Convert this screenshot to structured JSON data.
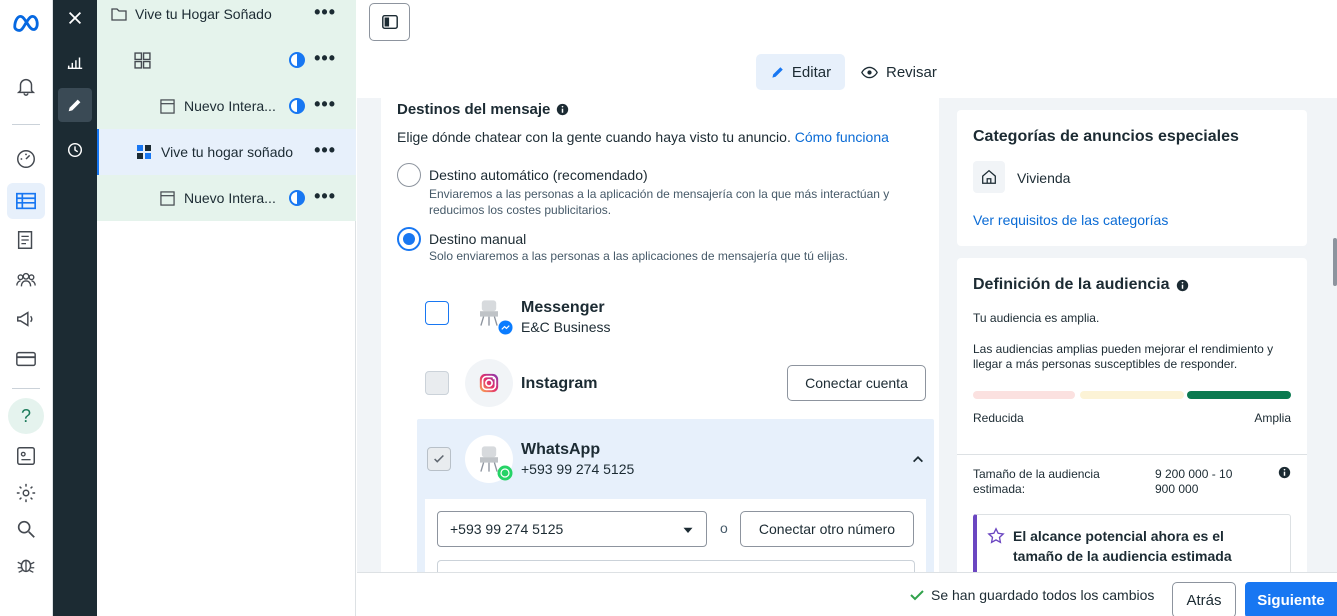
{
  "rail": {
    "icons": [
      "meta-logo-icon",
      "bell-icon",
      "gauge-icon",
      "table-icon",
      "catalog-icon",
      "audience-icon",
      "megaphone-icon",
      "billing-card-icon",
      "help-icon",
      "page-icon",
      "settings-icon",
      "search-icon",
      "bug-icon"
    ]
  },
  "tools": {
    "icons": [
      "close-icon",
      "chart-icon",
      "pencil-icon",
      "history-icon"
    ]
  },
  "tree": {
    "rows": [
      {
        "label": "Vive tu Hogar Soñado"
      },
      {
        "label": ""
      },
      {
        "label": "Nuevo Intera..."
      },
      {
        "label": "Vive tu hogar soñado"
      },
      {
        "label": "Nuevo Intera..."
      }
    ]
  },
  "header": {
    "edit_label": "Editar",
    "review_label": "Revisar"
  },
  "destinations": {
    "title": "Destinos del mensaje",
    "description": "Elige dónde chatear con la gente cuando haya visto tu anuncio.",
    "how_link": "Cómo funciona",
    "auto": {
      "label": "Destino automático (recomendado)",
      "help": "Enviaremos a las personas a la aplicación de mensajería con la que más interactúan y reducimos los costes publicitarios."
    },
    "manual": {
      "label": "Destino manual",
      "help": "Solo enviaremos a las personas a las aplicaciones de mensajería que tú elijas."
    },
    "messenger": {
      "name": "Messenger",
      "sub": "E&C Business"
    },
    "instagram": {
      "name": "Instagram",
      "button": "Conectar cuenta"
    },
    "whatsapp": {
      "name": "WhatsApp",
      "sub": "+593 99 274 5125",
      "select_value": "+593 99 274 5125",
      "or": "o",
      "connect_other": "Conectar otro número"
    }
  },
  "special_categories": {
    "title": "Categorías de anuncios especiales",
    "item": "Vivienda",
    "link": "Ver requisitos de las categorías"
  },
  "audience": {
    "title": "Definición de la audiencia",
    "status": "Tu audiencia es amplia.",
    "info": "Las audiencias amplias pueden mejorar el rendimiento y llegar a más personas susceptibles de responder.",
    "low_label": "Reducida",
    "high_label": "Amplia",
    "size_label": "Tamaño de la audiencia estimada:",
    "size_value": "9 200 000 - 10 900 000",
    "notice": "El alcance potencial ahora es el tamaño de la audiencia estimada"
  },
  "footer": {
    "saved": "Se han guardado todos los cambios",
    "back": "Atrás",
    "next": "Siguiente"
  },
  "colors": {
    "accent": "#1877f2",
    "tree_green": "#e5f3ec",
    "dark_tool": "#1c2b33",
    "meter_green": "#1b7a5a"
  }
}
